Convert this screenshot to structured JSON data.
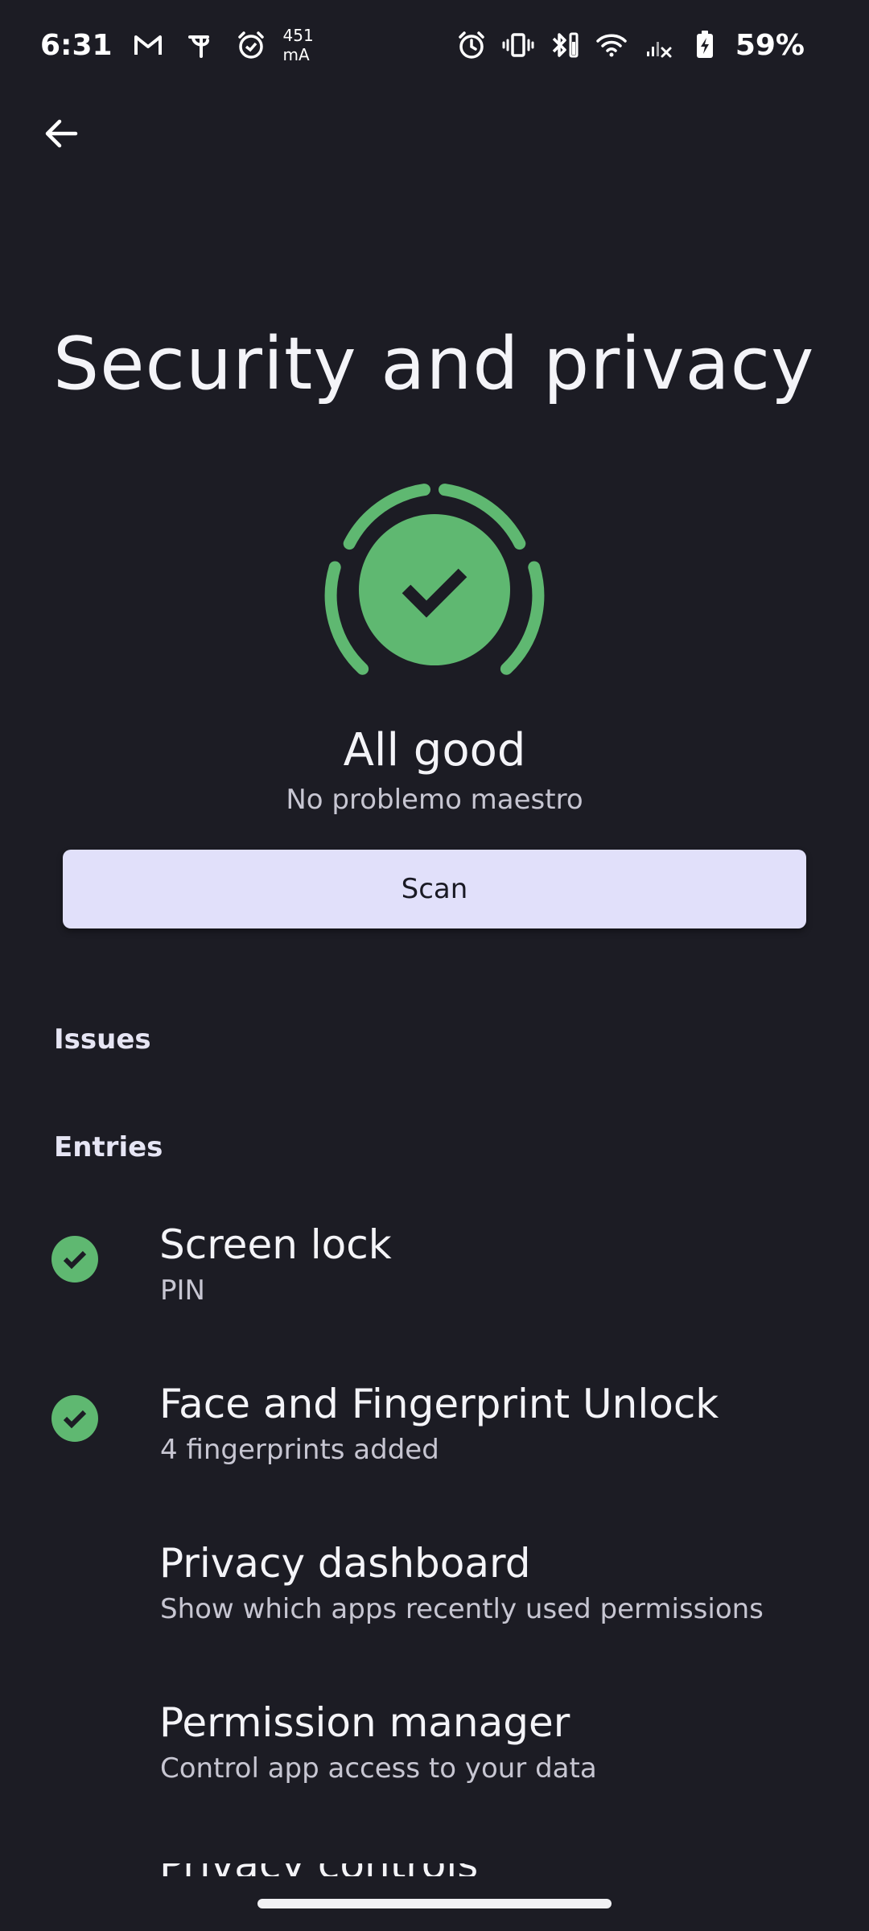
{
  "status_bar": {
    "time": "6:31",
    "current_value": "451",
    "current_unit": "mA",
    "battery_percent": "59%",
    "left_icons": [
      "gmail-icon",
      "phonepe-icon",
      "alarm-icon"
    ],
    "right_icons": [
      "alarm-icon",
      "vibrate-icon",
      "bluetooth-battery-icon",
      "wifi-icon",
      "no-signal-icon",
      "battery-charging-icon"
    ]
  },
  "header": {
    "back_icon": "arrow-back-icon",
    "title": "Security and privacy"
  },
  "status": {
    "headline": "All good",
    "subtext": "No problemo maestro",
    "scan_label": "Scan",
    "accent_color": "#5fb871"
  },
  "sections": {
    "issues_label": "Issues",
    "entries_label": "Entries"
  },
  "entries": [
    {
      "title": "Screen lock",
      "summary": "PIN",
      "checked": true
    },
    {
      "title": "Face and Fingerprint Unlock",
      "summary": "4 fingerprints added",
      "checked": true
    },
    {
      "title": "Privacy dashboard",
      "summary": "Show which apps recently used permissions",
      "checked": false
    },
    {
      "title": "Permission manager",
      "summary": "Control app access to your data",
      "checked": false
    },
    {
      "title": "Privacy controls",
      "summary": "",
      "checked": false
    }
  ]
}
